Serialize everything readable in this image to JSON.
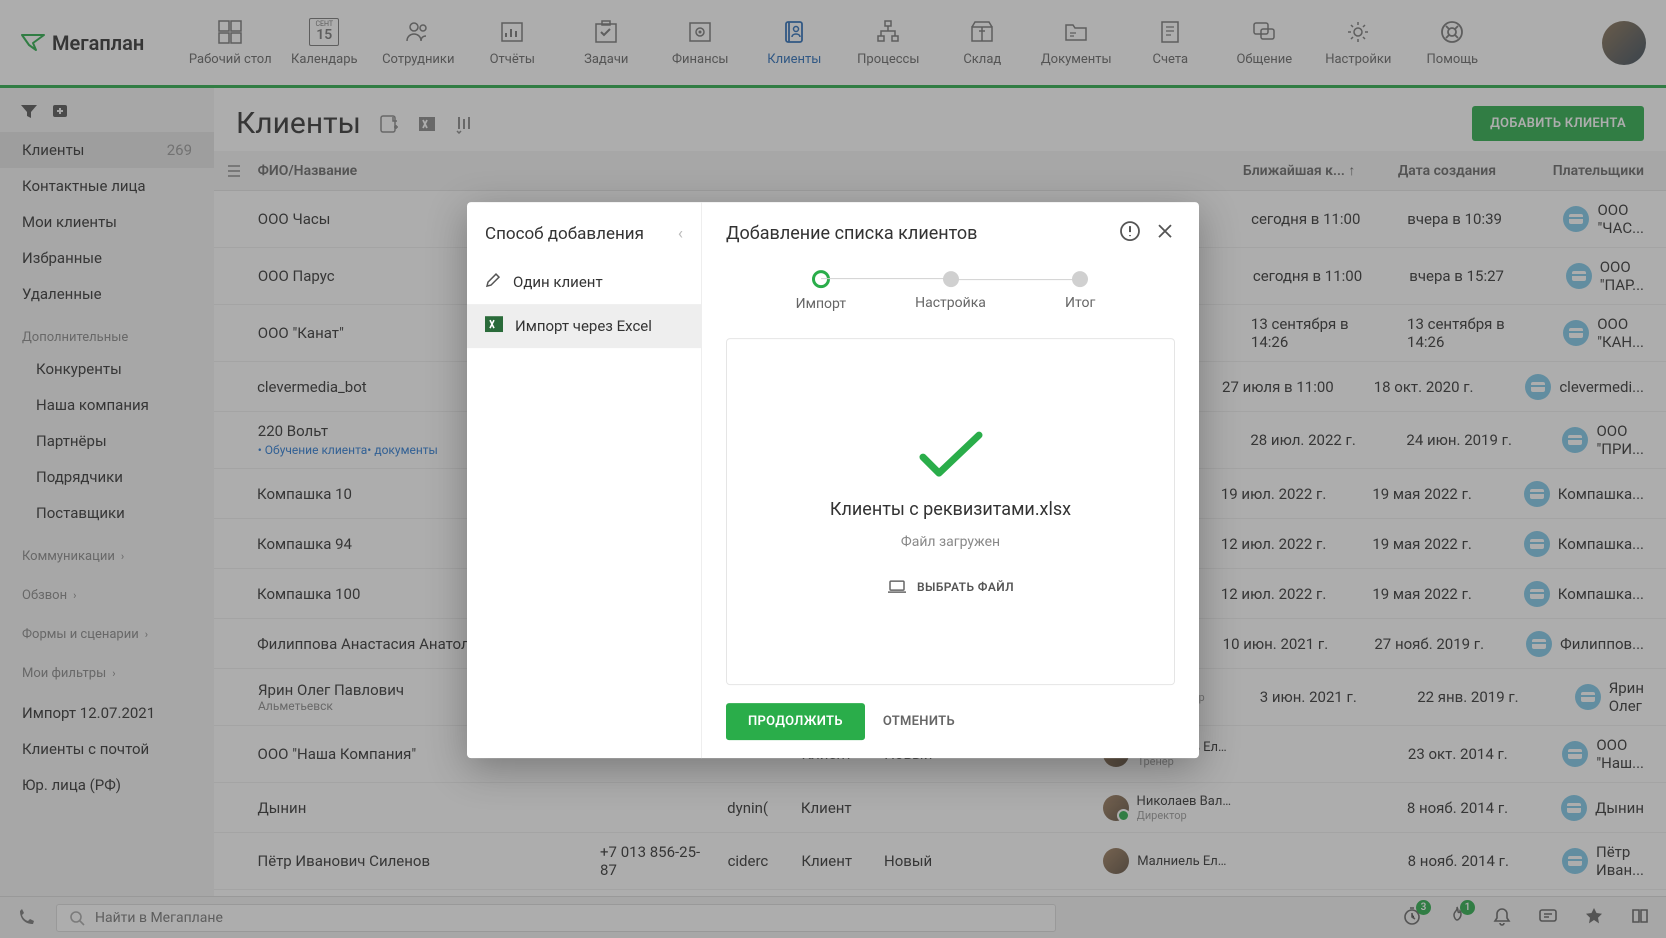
{
  "logo": "Мегаплан",
  "nav": [
    {
      "label": "Рабочий стол",
      "icon": "dashboard"
    },
    {
      "label": "Календарь",
      "icon": "calendar",
      "date": "15",
      "month": "СЕНТ"
    },
    {
      "label": "Сотрудники",
      "icon": "people"
    },
    {
      "label": "Отчёты",
      "icon": "chart"
    },
    {
      "label": "Задачи",
      "icon": "check"
    },
    {
      "label": "Финансы",
      "icon": "safe"
    },
    {
      "label": "Клиенты",
      "icon": "book",
      "active": true
    },
    {
      "label": "Процессы",
      "icon": "flow"
    },
    {
      "label": "Склад",
      "icon": "box"
    },
    {
      "label": "Документы",
      "icon": "folder"
    },
    {
      "label": "Счета",
      "icon": "invoice"
    },
    {
      "label": "Общение",
      "icon": "chat"
    },
    {
      "label": "Настройки",
      "icon": "gear"
    },
    {
      "label": "Помощь",
      "icon": "help"
    }
  ],
  "sidebar": {
    "main": [
      {
        "label": "Клиенты",
        "count": "269",
        "active": true
      },
      {
        "label": "Контактные лица"
      },
      {
        "label": "Мои клиенты"
      },
      {
        "label": "Избранные"
      },
      {
        "label": "Удаленные"
      }
    ],
    "groups": [
      {
        "title": "Дополнительные",
        "items": [
          "Конкуренты",
          "Наша компания",
          "Партнёры",
          "Подрядчики",
          "Поставщики"
        ]
      },
      {
        "title": "Коммуникации",
        "chevron": true
      },
      {
        "title": "Обзвон",
        "chevron": true
      },
      {
        "title": "Формы и сценарии",
        "chevron": true
      },
      {
        "title": "Мои фильтры",
        "chevron": true
      }
    ],
    "extra": [
      "Импорт 12.07.2021",
      "Клиенты с почтой",
      "Юр. лица (РФ)"
    ]
  },
  "page": {
    "title": "Клиенты",
    "addButton": "ДОБАВИТЬ КЛИЕНТА"
  },
  "columns": [
    "ФИО/Название",
    "",
    "",
    "",
    "",
    "",
    "",
    "Ближайшая к...",
    "Дата создания",
    "Плательщики"
  ],
  "rows": [
    {
      "name": "ООО Часы",
      "near": "сегодня в 11:00",
      "created": "вчера в 10:39",
      "payer": "ООО \"ЧАС..."
    },
    {
      "name": "ООО Парус",
      "near": "сегодня в 11:00",
      "created": "вчера в 15:27",
      "payer": "ООО \"ПАР..."
    },
    {
      "name": "ООО \"Канат\"",
      "near": "13 сентября в 14:26",
      "created": "13 сентября в 14:26",
      "payer": "ООО \"КАН..."
    },
    {
      "name": "clevermedia_bot",
      "near": "27 июля в 11:00",
      "created": "18 окт. 2020 г.",
      "payer": "clevermedi..."
    },
    {
      "name": "220 Вольт",
      "tags": [
        "Обучение клиента",
        "документы"
      ],
      "near": "28 июл. 2022 г.",
      "created": "24 июн. 2019 г.",
      "payer": "ООО \"ПРИ..."
    },
    {
      "name": "Компашка 10",
      "near": "19 июл. 2022 г.",
      "created": "19 мая 2022 г.",
      "payer": "Компашка..."
    },
    {
      "name": "Компашка 94",
      "near": "12 июл. 2022 г.",
      "created": "19 мая 2022 г.",
      "payer": "Компашка..."
    },
    {
      "name": "Компашка 100",
      "near": "12 июл. 2022 г.",
      "created": "19 мая 2022 г.",
      "payer": "Компашка..."
    },
    {
      "name": "Филиппова Анастасия Анатольевна",
      "near": "10 июн. 2021 г.",
      "created": "27 нояб. 2019 г.",
      "payer": "Филиппов..."
    },
    {
      "name": "Ярин Олег Павлович",
      "city": "Альметьевск",
      "resp": {
        "name": "",
        "role": "Директор"
      },
      "near": "3 июн. 2021 г.",
      "created": "22 янв. 2019 г.",
      "payer": "Ярин Олег"
    },
    {
      "name": "ООО \"Наша Компания\"",
      "type": "Клиент",
      "status": "Новый",
      "resp": {
        "name": "Малниель Еле...",
        "role": "Тренер"
      },
      "created": "23 окт. 2014 г.",
      "payer": "ООО \"Наш..."
    },
    {
      "name": "Дынин",
      "login": "dynin(",
      "type": "Клиент",
      "resp": {
        "name": "Николаев Вал...",
        "role": "Директор",
        "online": true
      },
      "created": "8 нояб. 2014 г.",
      "payer": "Дынин"
    },
    {
      "name": "Пётр Иванович Силенов",
      "phone": "+7 013 856-25-87",
      "login": "ciderc",
      "type": "Клиент",
      "status": "Новый",
      "resp": {
        "name": "Малниель Еле...",
        "role": ""
      },
      "created": "8 нояб. 2014 г.",
      "payer": "Пётр Иван..."
    }
  ],
  "search": {
    "placeholder": "Найти в Мегаплане"
  },
  "bottomBadges": {
    "clock": "3",
    "fire": "1"
  },
  "modal": {
    "leftTitle": "Способ добавления",
    "leftItems": [
      {
        "label": "Один клиент",
        "icon": "pen"
      },
      {
        "label": "Импорт через Excel",
        "icon": "excel",
        "active": true
      }
    ],
    "title": "Добавление списка клиентов",
    "steps": [
      "Импорт",
      "Настройка",
      "Итог"
    ],
    "activeStep": 0,
    "fileName": "Клиенты с реквизитами.xlsx",
    "fileStatus": "Файл загружен",
    "chooseFile": "ВЫБРАТЬ ФАЙЛ",
    "continue": "ПРОДОЛЖИТЬ",
    "cancel": "ОТМЕНИТЬ"
  }
}
